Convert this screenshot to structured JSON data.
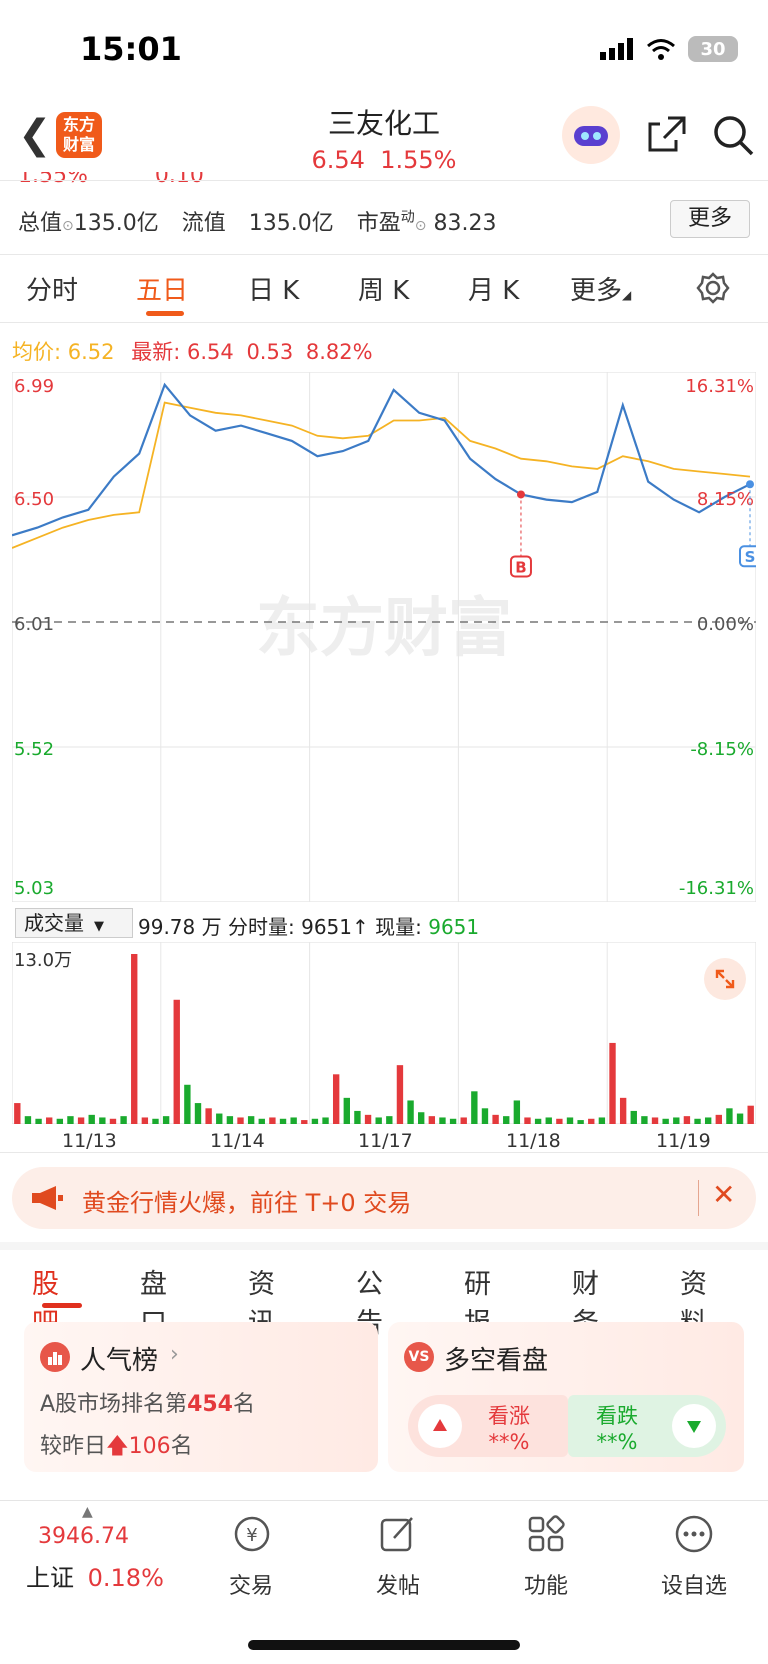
{
  "status": {
    "time": "15:01",
    "battery": "30"
  },
  "header": {
    "logo_text_1": "东方",
    "logo_text_2": "财富",
    "title": "三友化工",
    "price": "6.54",
    "change_pct": "1.55%"
  },
  "info_row": {
    "cropped_left": "1.55%",
    "cropped_right": "0.10",
    "total_label": "总值",
    "total_value": "135.0亿",
    "float_label": "流值",
    "float_value": "135.0亿",
    "pe_label": "市盈",
    "pe_sup": "动",
    "pe_value": "83.23",
    "more_label": "更多"
  },
  "tabs": [
    "分时",
    "五日",
    "日 K",
    "周 K",
    "月 K",
    "更多"
  ],
  "active_tab": "五日",
  "avg_bar": {
    "avg_label": "均价:",
    "avg_value": "6.52",
    "latest_label": "最新:",
    "latest_value": "6.54",
    "change": "0.53",
    "change_pct": "8.82%"
  },
  "chart_data": {
    "type": "line",
    "days": [
      "11/13",
      "11/14",
      "11/17",
      "11/18",
      "11/19"
    ],
    "y_left_ticks": [
      "6.99",
      "6.50",
      "6.01",
      "5.52",
      "5.03"
    ],
    "y_right_ticks": [
      "16.31%",
      "8.15%",
      "0.00%",
      "-8.15%",
      "-16.31%"
    ],
    "ylim": [
      5.03,
      6.99
    ],
    "baseline": 6.01,
    "markers": [
      {
        "label": "B",
        "color": "#e4393c"
      },
      {
        "label": "S",
        "color": "#4a90e2"
      }
    ],
    "series": [
      {
        "name": "均价",
        "color": "#f5b324",
        "values": [
          6.3,
          6.34,
          6.38,
          6.41,
          6.43,
          6.44,
          6.87,
          6.85,
          6.83,
          6.82,
          6.8,
          6.78,
          6.74,
          6.73,
          6.74,
          6.8,
          6.8,
          6.81,
          6.72,
          6.69,
          6.65,
          6.64,
          6.62,
          6.61,
          6.66,
          6.64,
          6.61,
          6.6,
          6.59,
          6.58
        ]
      },
      {
        "name": "price",
        "color": "#3c7bc6",
        "values": [
          6.35,
          6.38,
          6.42,
          6.45,
          6.58,
          6.67,
          6.94,
          6.82,
          6.76,
          6.78,
          6.75,
          6.72,
          6.66,
          6.68,
          6.72,
          6.92,
          6.83,
          6.8,
          6.65,
          6.57,
          6.51,
          6.49,
          6.48,
          6.52,
          6.86,
          6.56,
          6.49,
          6.44,
          6.5,
          6.55
        ]
      }
    ],
    "volume": {
      "label": "成交量",
      "total": "99.78 万",
      "minute_label": "分时量:",
      "minute_value": "9651",
      "now_label": "现量:",
      "now_value": "9651",
      "y_max_label": "13.0万",
      "values": [
        1.6,
        0.6,
        0.4,
        0.5,
        0.4,
        0.6,
        0.5,
        0.7,
        0.5,
        0.4,
        0.6,
        13.0,
        0.5,
        0.4,
        0.6,
        9.5,
        3.0,
        1.6,
        1.2,
        0.8,
        0.6,
        0.5,
        0.6,
        0.4,
        0.5,
        0.4,
        0.5,
        0.3,
        0.4,
        0.5,
        3.8,
        2.0,
        1.0,
        0.7,
        0.5,
        0.6,
        4.5,
        1.8,
        0.9,
        0.6,
        0.5,
        0.4,
        0.5,
        2.5,
        1.2,
        0.7,
        0.6,
        1.8,
        0.5,
        0.4,
        0.5,
        0.4,
        0.5,
        0.3,
        0.4,
        0.5,
        6.2,
        2.0,
        1.0,
        0.6,
        0.5,
        0.4,
        0.5,
        0.6,
        0.4,
        0.5,
        0.7,
        1.2,
        0.8,
        1.4
      ]
    }
  },
  "banner": {
    "text": "黄金行情火爆，前往 T+0 交易"
  },
  "subtabs": [
    "股吧",
    "盘口",
    "资讯",
    "公告",
    "研报",
    "财务",
    "资料"
  ],
  "rank_card": {
    "title": "人气榜",
    "line1_prefix": "A股市场排名第",
    "rank": "454",
    "line1_suffix": "名",
    "line2_prefix": "较昨日",
    "rank_change": "106",
    "line2_suffix": "名"
  },
  "sentiment_card": {
    "title": "多空看盘",
    "up_label": "看涨",
    "up_value": "**%",
    "down_label": "看跌",
    "down_value": "**%"
  },
  "bottom_bar": {
    "index_value": "3946.74",
    "index_name": "上证",
    "index_pct": "0.18%",
    "items": [
      "交易",
      "发帖",
      "功能",
      "设自选"
    ]
  },
  "watermark": "东方财富",
  "colors": {
    "accent": "#f05a1a",
    "up": "#e4393c",
    "down": "#1aaa2e",
    "price_line": "#3c7bc6",
    "avg_line": "#f5b324"
  }
}
